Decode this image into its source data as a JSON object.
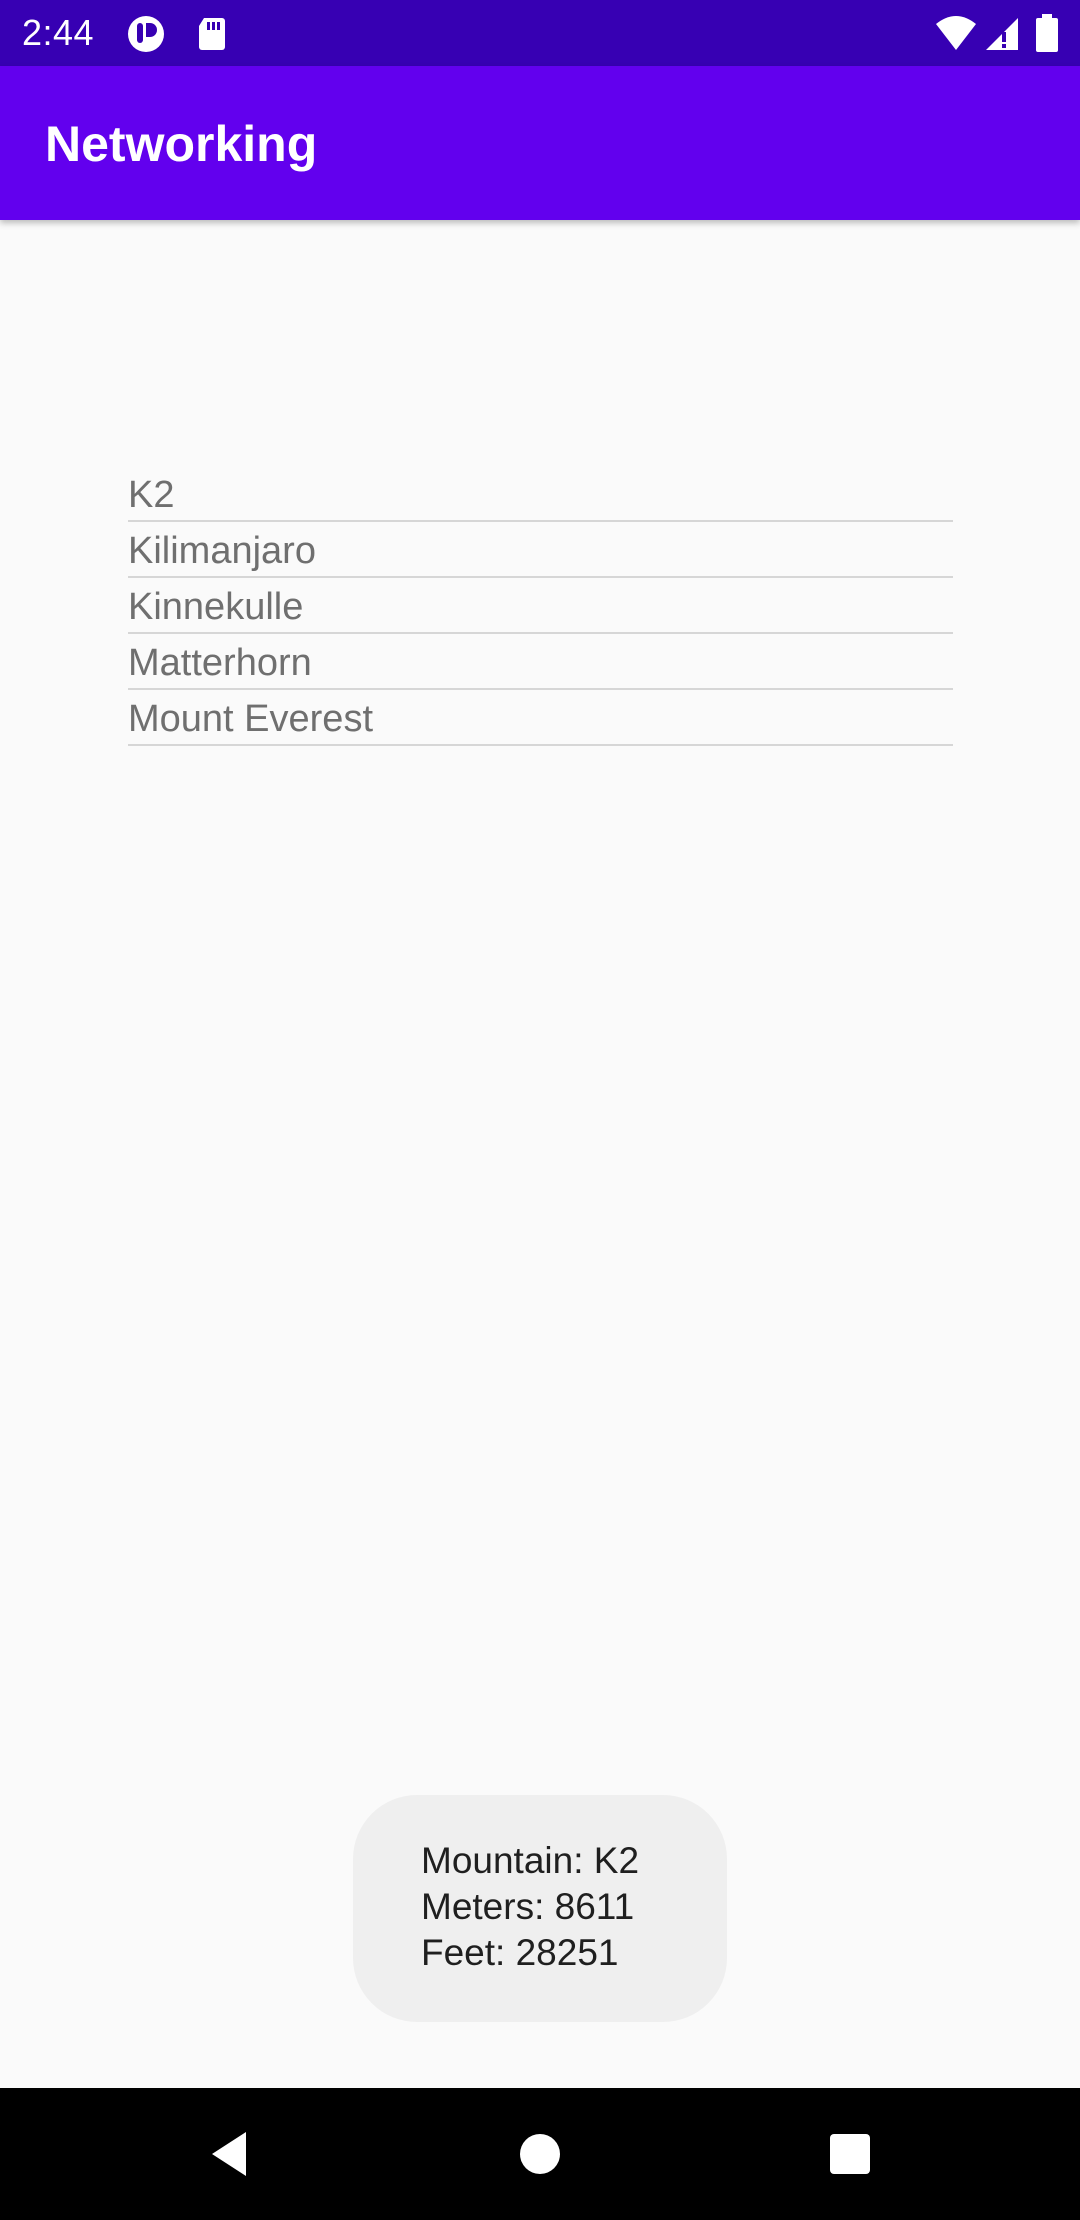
{
  "status_bar": {
    "time": "2:44",
    "icons": [
      "notification-app-icon",
      "sd-card-icon",
      "wifi-icon",
      "cellular-signal-icon",
      "battery-icon"
    ]
  },
  "app_bar": {
    "title": "Networking",
    "color": "#6200ee",
    "status_color": "#3700b3"
  },
  "mountain_list": {
    "items": [
      {
        "label": "K2"
      },
      {
        "label": "Kilimanjaro"
      },
      {
        "label": "Kinnekulle"
      },
      {
        "label": "Matterhorn"
      },
      {
        "label": "Mount Everest"
      }
    ]
  },
  "toast": {
    "line1": "Mountain: K2",
    "line2": "Meters: 8611",
    "line3": "Feet: 28251"
  },
  "nav_bar": {
    "icons": [
      "back-icon",
      "home-icon",
      "recents-icon"
    ]
  }
}
